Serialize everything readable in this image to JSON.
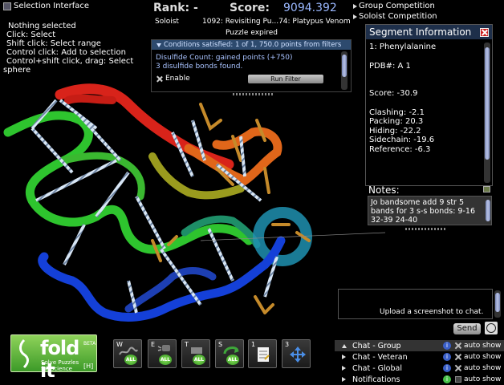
{
  "selection": {
    "title": "Selection Interface",
    "lines": [
      "Nothing selected",
      "Click: Select",
      "Shift click: Select range",
      "Control click: Add to selection",
      "Control+shift click, drag: Select",
      "sphere"
    ]
  },
  "score_panel": {
    "rank_label": "Rank: -",
    "score_label": "Score:",
    "score_value": "9094.392",
    "role": "Soloist",
    "puzzle_name": "1092: Revisiting Pu...74: Platypus Venom",
    "puzzle_status": "Puzzle expired"
  },
  "competitions": [
    "Group Competition",
    "Soloist Competition"
  ],
  "conditions": {
    "header": "Conditions satisfied: 1 of 1, 750.0 points from filters",
    "line1": "Disulfide Count: gained points (+750)",
    "line2": "3 disulfide bonds found.",
    "enable_label": "Enable",
    "run_filter": "Run Filter"
  },
  "segment": {
    "title": "Segment Information",
    "name": "1: Phenylalanine",
    "pdb": "PDB#: A 1",
    "score": "Score: -30.9",
    "clashing": "Clashing: -2.1",
    "packing": "Packing: 20.3",
    "hiding": "Hiding: -22.2",
    "sidechain": "Sidechain: -19.6",
    "reference": "Reference: -6.3"
  },
  "notes": {
    "label": "Notes:",
    "text": "Jo bandsome add 9 str 5 bands for 3 s-s bonds: 9-16 32-39 24-40"
  },
  "chat": {
    "upload_hint": "Upload a screenshot to chat.",
    "send": "Send",
    "tabs": [
      {
        "label": "Chat - Group",
        "auto": "auto show"
      },
      {
        "label": "Chat - Veteran",
        "auto": "auto show"
      },
      {
        "label": "Chat - Global",
        "auto": "auto show"
      },
      {
        "label": "Notifications",
        "auto": "auto show"
      }
    ]
  },
  "logo": {
    "word": "fold it",
    "beta": "BETA",
    "tag1": "Solve Puzzles",
    "tag2": "for Science",
    "hotkey": "[H]"
  },
  "toolbar": {
    "buttons": [
      {
        "key": "W",
        "badge": "ALL"
      },
      {
        "key": "E",
        "badge": "ALL"
      },
      {
        "key": "T",
        "badge": "ALL"
      },
      {
        "key": "S",
        "badge": "ALL"
      },
      {
        "key": "1",
        "badge": ""
      },
      {
        "key": "3",
        "badge": ""
      }
    ]
  },
  "colors": {
    "score_value": "#9ab8ff",
    "condition_text": "#a9c3ff",
    "header_blue": "#2d4a6e",
    "logo_green": "#5ab53a"
  }
}
